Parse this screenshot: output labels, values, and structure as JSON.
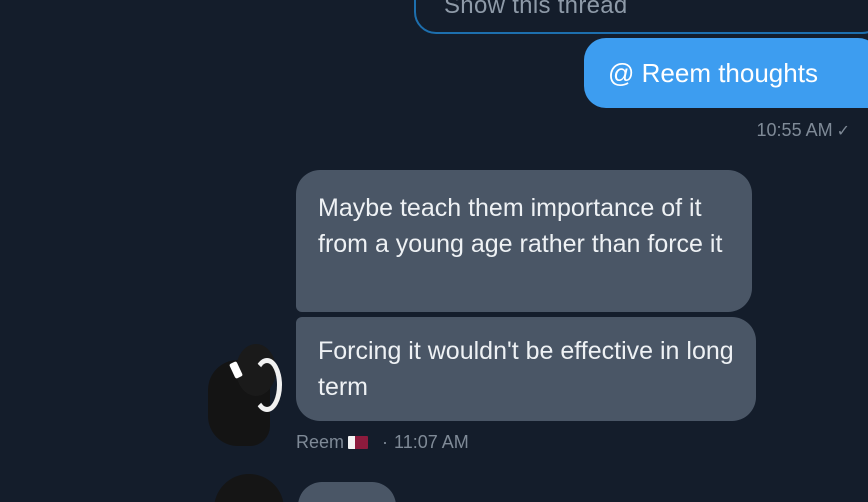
{
  "thread": {
    "label": "Show this thread"
  },
  "outgoing": {
    "text": "@ Reem thoughts",
    "time": "10:55 AM",
    "check_icon": "check-icon"
  },
  "incoming": {
    "messages": [
      "Maybe teach them importance of it from a young age rather than force it",
      "Forcing it wouldn't be effective in long term"
    ],
    "sender": "Reem",
    "time": "11:07 AM",
    "flag_icon": "qatar-flag-icon"
  },
  "colors": {
    "background": "#141d2b",
    "outgoing_bubble": "#3d9df0",
    "incoming_bubble": "#4a5666",
    "meta_text": "#7f8a97"
  }
}
